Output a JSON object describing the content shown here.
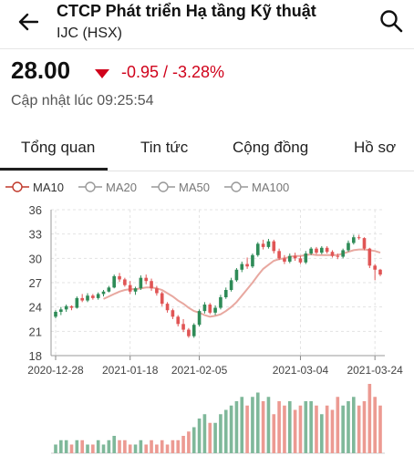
{
  "header": {
    "title": "CTCP Phát triển Hạ tầng Kỹ thuật",
    "subtitle": "IJC (HSX)",
    "back_icon": "arrow-left-icon",
    "search_icon": "search-icon"
  },
  "quote": {
    "price": "28.00",
    "change": "-0.95 / -3.28%",
    "direction_icon": "triangle-down-icon",
    "updated": "Cập nhật lúc 09:25:54"
  },
  "tabs": [
    {
      "label": "Tổng quan",
      "active": true
    },
    {
      "label": "Tin tức",
      "active": false
    },
    {
      "label": "Cộng đồng",
      "active": false
    },
    {
      "label": "Hồ sơ",
      "active": false
    }
  ],
  "legend": [
    {
      "label": "MA10",
      "active": true,
      "color": "#c0392b"
    },
    {
      "label": "MA20",
      "active": false,
      "color": "#999999"
    },
    {
      "label": "MA50",
      "active": false,
      "color": "#999999"
    },
    {
      "label": "MA100",
      "active": false,
      "color": "#999999"
    }
  ],
  "colors": {
    "up": "#2e8b57",
    "down": "#e05555",
    "ma10": "#e8a8a0",
    "accent_down": "#d0021b"
  },
  "chart_data": {
    "type": "candlestick",
    "ylim": [
      18,
      36
    ],
    "yticks": [
      "36",
      "33",
      "30",
      "27",
      "24",
      "21",
      "18"
    ],
    "xticks": [
      "2020-12-28",
      "2021-01-18",
      "2021-02-05",
      "2021-03-04",
      "2021-03-24"
    ],
    "xtick_index": [
      0,
      14,
      27,
      46,
      60
    ],
    "candles": [
      [
        22.8,
        23.6,
        22.6,
        23.4
      ],
      [
        23.4,
        24.0,
        23.0,
        23.7
      ],
      [
        23.7,
        24.3,
        23.4,
        24.1
      ],
      [
        24.1,
        24.2,
        23.6,
        23.9
      ],
      [
        23.9,
        25.3,
        23.8,
        25.1
      ],
      [
        25.1,
        25.6,
        24.6,
        24.8
      ],
      [
        24.8,
        25.7,
        24.6,
        25.4
      ],
      [
        25.4,
        25.6,
        24.9,
        25.1
      ],
      [
        25.1,
        25.8,
        24.9,
        25.6
      ],
      [
        25.6,
        26.1,
        25.3,
        25.9
      ],
      [
        25.9,
        26.6,
        25.8,
        26.4
      ],
      [
        26.4,
        28.0,
        26.3,
        27.8
      ],
      [
        27.8,
        28.2,
        27.1,
        27.4
      ],
      [
        27.4,
        27.6,
        26.5,
        26.7
      ],
      [
        26.7,
        27.2,
        25.6,
        25.9
      ],
      [
        25.9,
        26.5,
        25.5,
        26.3
      ],
      [
        26.3,
        27.9,
        26.1,
        27.6
      ],
      [
        27.6,
        28.0,
        26.8,
        27.2
      ],
      [
        27.2,
        27.5,
        26.0,
        26.3
      ],
      [
        26.3,
        26.6,
        25.4,
        25.7
      ],
      [
        25.7,
        25.9,
        24.1,
        24.4
      ],
      [
        24.4,
        24.6,
        23.3,
        23.6
      ],
      [
        23.6,
        23.8,
        22.5,
        22.8
      ],
      [
        22.8,
        23.0,
        21.6,
        21.9
      ],
      [
        21.9,
        22.5,
        20.9,
        21.2
      ],
      [
        21.2,
        21.4,
        20.2,
        20.4
      ],
      [
        20.4,
        22.0,
        20.2,
        21.8
      ],
      [
        21.8,
        23.7,
        21.6,
        23.5
      ],
      [
        23.5,
        24.6,
        23.2,
        24.3
      ],
      [
        24.3,
        24.5,
        23.1,
        23.3
      ],
      [
        23.3,
        24.2,
        23.0,
        23.9
      ],
      [
        23.9,
        25.5,
        23.7,
        25.2
      ],
      [
        25.2,
        26.4,
        25.0,
        26.1
      ],
      [
        26.1,
        27.6,
        25.9,
        27.3
      ],
      [
        27.3,
        28.8,
        27.1,
        28.6
      ],
      [
        28.6,
        29.6,
        28.3,
        29.3
      ],
      [
        29.3,
        30.1,
        28.7,
        29.0
      ],
      [
        29.0,
        30.6,
        28.8,
        30.4
      ],
      [
        30.4,
        32.0,
        30.2,
        31.8
      ],
      [
        31.8,
        32.3,
        31.1,
        31.4
      ],
      [
        31.4,
        32.4,
        31.2,
        32.1
      ],
      [
        32.1,
        32.3,
        30.6,
        30.9
      ],
      [
        30.9,
        31.2,
        29.8,
        30.0
      ],
      [
        30.0,
        30.4,
        29.3,
        29.6
      ],
      [
        29.6,
        30.6,
        29.4,
        30.3
      ],
      [
        30.3,
        30.7,
        29.7,
        30.0
      ],
      [
        30.0,
        30.3,
        29.3,
        29.5
      ],
      [
        29.5,
        30.9,
        29.3,
        30.6
      ],
      [
        30.6,
        31.4,
        30.4,
        31.2
      ],
      [
        31.2,
        31.4,
        30.5,
        30.7
      ],
      [
        30.7,
        31.5,
        30.5,
        31.3
      ],
      [
        31.3,
        31.5,
        30.6,
        30.8
      ],
      [
        30.8,
        31.0,
        30.1,
        30.3
      ],
      [
        30.3,
        30.6,
        29.9,
        30.2
      ],
      [
        30.2,
        31.2,
        30.0,
        31.0
      ],
      [
        31.0,
        32.2,
        30.8,
        31.9
      ],
      [
        31.9,
        32.9,
        31.7,
        32.6
      ],
      [
        32.6,
        32.9,
        32.3,
        32.5
      ],
      [
        32.5,
        32.6,
        31.0,
        31.2
      ],
      [
        31.2,
        31.3,
        28.8,
        29.1
      ],
      [
        29.1,
        29.3,
        27.3,
        28.6
      ],
      [
        28.6,
        28.7,
        27.8,
        28.0
      ]
    ],
    "volumes": [
      2,
      3,
      3,
      2,
      3,
      3,
      2,
      2,
      3,
      2,
      3,
      4,
      3,
      3,
      2,
      2,
      3,
      2,
      3,
      2,
      3,
      2,
      3,
      3,
      4,
      5,
      6,
      8,
      9,
      7,
      7,
      9,
      10,
      11,
      12,
      13,
      11,
      13,
      14,
      12,
      13,
      9,
      12,
      11,
      12,
      10,
      11,
      12,
      12,
      11,
      9,
      11,
      10,
      13,
      11,
      12,
      13,
      11,
      12,
      16,
      13,
      11
    ],
    "ma10": [
      null,
      null,
      null,
      null,
      null,
      null,
      null,
      null,
      null,
      25.0,
      25.3,
      25.6,
      25.9,
      26.1,
      26.2,
      26.2,
      26.3,
      26.4,
      26.4,
      26.3,
      26.1,
      25.7,
      25.3,
      24.8,
      24.4,
      23.9,
      23.5,
      23.3,
      23.0,
      22.8,
      22.9,
      23.1,
      23.5,
      24.0,
      24.6,
      25.4,
      26.2,
      27.0,
      27.9,
      28.7,
      29.2,
      29.7,
      29.9,
      30.0,
      30.2,
      30.3,
      30.3,
      30.4,
      30.5,
      30.4,
      30.4,
      30.4,
      30.4,
      30.4,
      30.6,
      30.8,
      31.0,
      31.1,
      31.1,
      31.0,
      30.9,
      30.7
    ]
  }
}
